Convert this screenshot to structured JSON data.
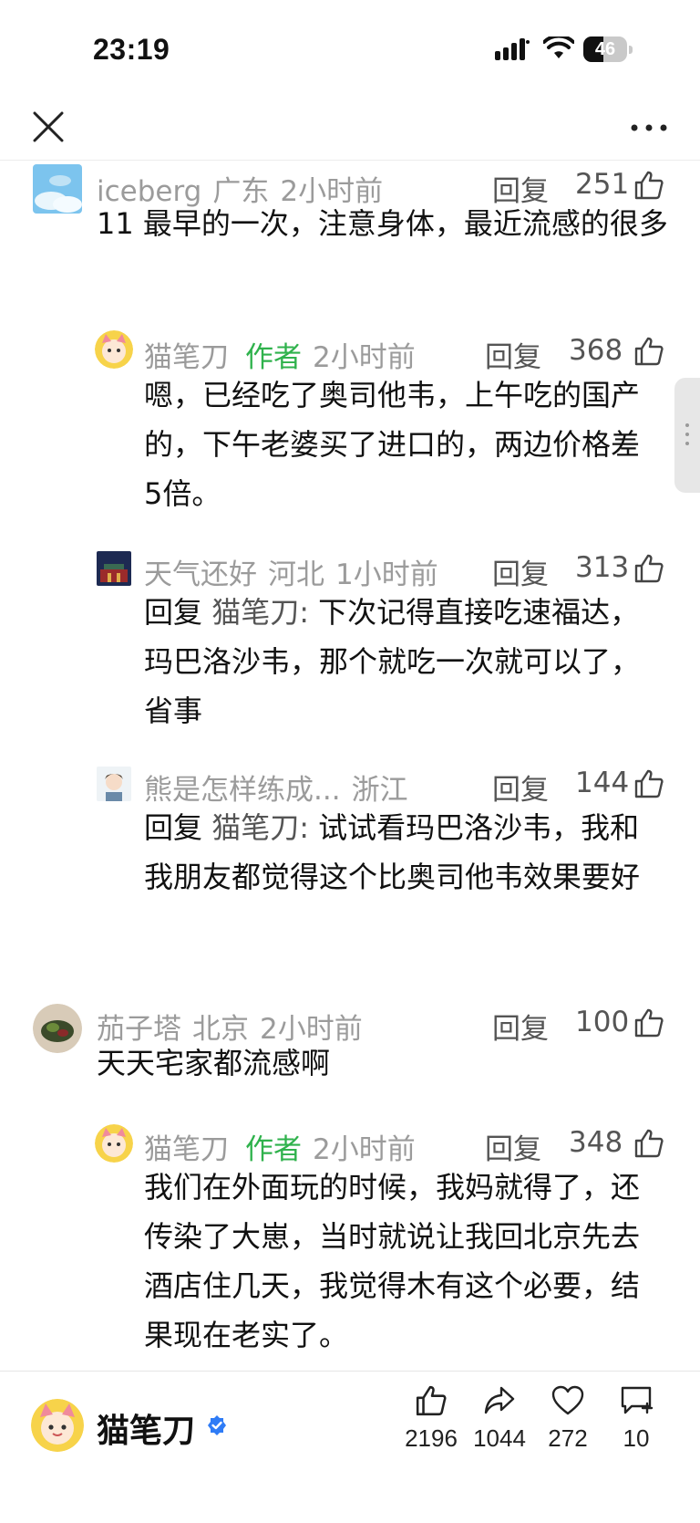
{
  "status_bar": {
    "time": "23:19",
    "battery": "46",
    "battery_level": 0.46
  },
  "comments": [
    {
      "user": "iceberg",
      "location": "广东",
      "time": "2小时前",
      "reply": "回复",
      "likes": "251",
      "text": "11 最早的一次，注意身体，最近流感的很多"
    },
    {
      "user": "猫笔刀",
      "author_tag": "作者",
      "time": "2小时前",
      "reply": "回复",
      "likes": "368",
      "text": "嗯，已经吃了奥司他韦，上午吃的国产的，下午老婆买了进口的，两边价格差5倍。"
    },
    {
      "user": "天气还好",
      "location": "河北",
      "time": "1小时前",
      "reply": "回复",
      "likes": "313",
      "reply_prefix": "回复",
      "reply_to": "猫笔刀:",
      "text": "下次记得直接吃速福达，玛巴洛沙韦，那个就吃一次就可以了，省事"
    },
    {
      "user": "熊是怎样练成...",
      "location": "浙江",
      "reply": "回复",
      "likes": "144",
      "reply_prefix": "回复",
      "reply_to": "猫笔刀:",
      "text": "试试看玛巴洛沙韦，我和我朋友都觉得这个比奥司他韦效果要好"
    },
    {
      "user": "茄子塔",
      "location": "北京",
      "time": "2小时前",
      "reply": "回复",
      "likes": "100",
      "text": "天天宅家都流感啊"
    },
    {
      "user": "猫笔刀",
      "author_tag": "作者",
      "time": "2小时前",
      "reply": "回复",
      "likes": "348",
      "text": "我们在外面玩的时候，我妈就得了，还传染了大崽，当时就说让我回北京先去酒店住几天，我觉得木有这个必要，结果现在老实了。"
    }
  ],
  "bottom_bar": {
    "author_name": "猫笔刀",
    "actions": [
      {
        "icon": "thumbs-up-icon",
        "count": "2196"
      },
      {
        "icon": "share-icon",
        "count": "1044"
      },
      {
        "icon": "heart-icon",
        "count": "272"
      },
      {
        "icon": "comment-icon",
        "count": "10"
      }
    ]
  }
}
